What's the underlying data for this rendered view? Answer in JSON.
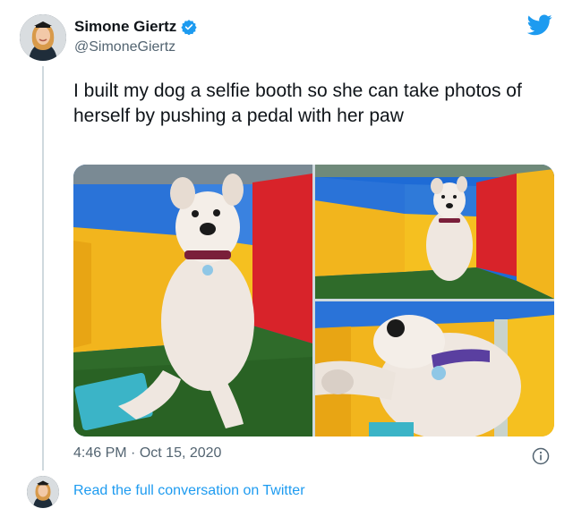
{
  "author": {
    "display_name": "Simone Giertz",
    "handle": "@SimoneGiertz",
    "verified": true
  },
  "tweet": {
    "text": "I built my dog a selfie booth so she can take photos of herself by pushing a pedal with her paw",
    "time": "4:46 PM",
    "separator": "·",
    "date": "Oct 15, 2020"
  },
  "media": {
    "photo_count": 3
  },
  "footer": {
    "read_more_label": "Read the full conversation on Twitter"
  },
  "colors": {
    "brand_blue": "#1d9bf0",
    "text_primary": "#0f1419",
    "text_secondary": "#536471",
    "thread_line": "#cfd9de"
  },
  "icons": {
    "logo": "twitter-bird-icon",
    "verified": "verified-badge-icon",
    "info": "info-icon"
  }
}
